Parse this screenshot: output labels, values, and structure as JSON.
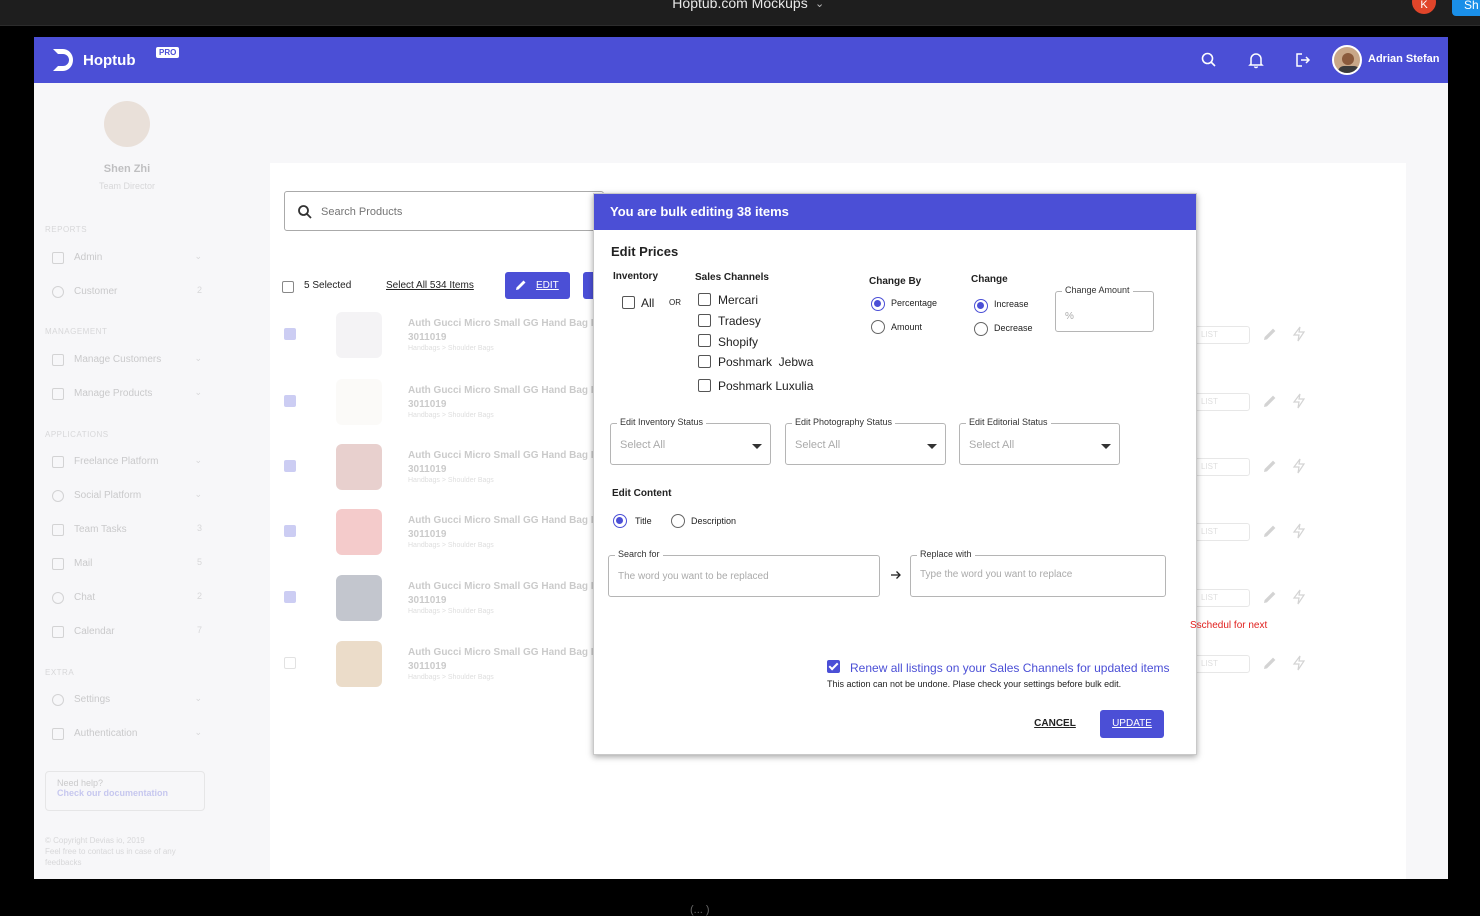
{
  "window": {
    "title": "Hoptub.com Mockups",
    "avatar_initial": "K",
    "share_label": "Sh",
    "caption": "(... )"
  },
  "header": {
    "brand": "Hoptub",
    "badge": "PRO",
    "user_name": "Adrian Stefan",
    "icons": [
      "search-icon",
      "bell-icon",
      "logout-icon"
    ]
  },
  "sidebar": {
    "profile_name": "Shen Zhi",
    "profile_role": "Team Director",
    "sections": [
      {
        "label": "REPORTS",
        "items": [
          {
            "label": "Admin",
            "badge": "⌄"
          },
          {
            "label": "Customer",
            "badge": "2"
          }
        ]
      },
      {
        "label": "MANAGEMENT",
        "items": [
          {
            "label": "Manage Customers",
            "badge": "⌄"
          },
          {
            "label": "Manage Products",
            "badge": "⌄"
          }
        ]
      },
      {
        "label": "APPLICATIONS",
        "items": [
          {
            "label": "Freelance Platform",
            "badge": "⌄"
          },
          {
            "label": "Social Platform",
            "badge": "⌄"
          },
          {
            "label": "Team Tasks",
            "badge": "3"
          },
          {
            "label": "Mail",
            "badge": "5"
          },
          {
            "label": "Chat",
            "badge": "2"
          },
          {
            "label": "Calendar",
            "badge": "7"
          }
        ]
      },
      {
        "label": "EXTRA",
        "items": [
          {
            "label": "Settings",
            "badge": "⌄"
          },
          {
            "label": "Authentication",
            "badge": "⌄"
          }
        ]
      }
    ],
    "help_title": "Need help?",
    "help_link": "Check our documentation",
    "copyright": "© Copyright Devias io, 2019",
    "footer_note": "Feel free to contact us in case of any feedbacks"
  },
  "toolbar": {
    "search_placeholder": "Search Products",
    "selected_count": "5 Selected",
    "select_all": "Select All 534 Items",
    "edit_label": "EDIT"
  },
  "products": [
    {
      "title": "Auth Gucci Micro Small GG Hand Bag Iv",
      "sku": "3011019",
      "category": "Handbags > Shoulder Bags",
      "checked": true,
      "color": "#d8d6dc",
      "action": "LIST"
    },
    {
      "title": "Auth Gucci Micro Small GG Hand Bag Iv",
      "sku": "3011019",
      "category": "Handbags > Shoulder Bags",
      "checked": true,
      "color": "#f1efe8",
      "action": "LIST"
    },
    {
      "title": "Auth Gucci Micro Small GG Hand Bag Iv",
      "sku": "3011019",
      "category": "Handbags > Shoulder Bags",
      "checked": true,
      "color": "#b05a52",
      "action": "LIST"
    },
    {
      "title": "Auth Gucci Micro Small GG Hand Bag Iv",
      "sku": "3011019",
      "category": "Handbags > Shoulder Bags",
      "checked": true,
      "color": "#d84848",
      "action": "LIST"
    },
    {
      "title": "Auth Gucci Micro Small GG Hand Bag Iv",
      "sku": "3011019",
      "category": "Handbags > Shoulder Bags",
      "checked": true,
      "color": "#2c3552",
      "action": "LIST"
    },
    {
      "title": "Auth Gucci Micro Small GG Hand Bag Iv",
      "sku": "3011019",
      "category": "Handbags > Shoulder Bags",
      "checked": false,
      "color": "#b88642",
      "action": "LIST"
    }
  ],
  "modal": {
    "header": "You are bulk editing 38 items",
    "edit_prices": "Edit Prices",
    "inventory_label": "Inventory",
    "all_label": "All",
    "or_label": "OR",
    "sales_channels_label": "Sales Channels",
    "channels": [
      "Mercari",
      "Tradesy",
      "Shopify",
      "Poshmark  Jebwa",
      "Poshmark Luxulia"
    ],
    "change_by_label": "Change By",
    "change_by_options": [
      "Percentage",
      "Amount"
    ],
    "change_by_selected": "Percentage",
    "change_label": "Change",
    "change_options": [
      "Increase",
      "Decrease"
    ],
    "change_selected": "Increase",
    "change_amount_label": "Change Amount",
    "change_amount_placeholder": "%",
    "status_fields": [
      {
        "label": "Edit Inventory Status",
        "value": "Select All"
      },
      {
        "label": "Edit Photography Status",
        "value": "Select All"
      },
      {
        "label": "Edit Editorial Status",
        "value": "Select All"
      }
    ],
    "edit_content_label": "Edit Content",
    "content_options": [
      "Title",
      "Description"
    ],
    "content_selected": "Title",
    "search_for_label": "Search for",
    "search_for_placeholder": "The word you want to be replaced",
    "replace_with_label": "Replace with",
    "replace_with_placeholder": "Type the word you want to replace",
    "renew_label": "Renew all listings on your Sales Channels for updated items",
    "renew_checked": true,
    "warning": "This action can not be undone. Plase check your settings before bulk edit.",
    "cancel_label": "CANCEL",
    "update_label": "UPDATE"
  },
  "annotation": "Sschedul for next",
  "colors": {
    "primary": "#4b4fd6",
    "annotation": "#e0201e"
  }
}
